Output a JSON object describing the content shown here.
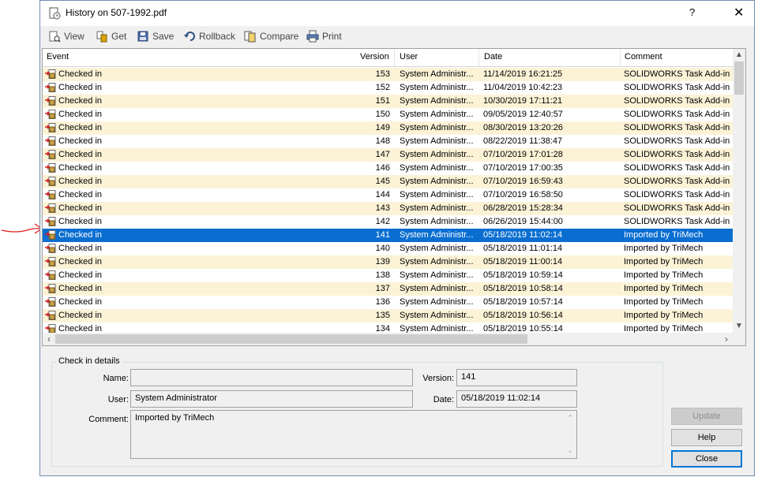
{
  "window": {
    "title": "History on 507-1992.pdf",
    "help_glyph": "?",
    "close_glyph": "✕"
  },
  "toolbar": {
    "view": "View",
    "get": "Get",
    "save": "Save",
    "rollback": "Rollback",
    "compare": "Compare",
    "print": "Print"
  },
  "columns": {
    "event": "Event",
    "version": "Version",
    "user": "User",
    "date": "Date",
    "comment": "Comment"
  },
  "rows": [
    {
      "event": "Checked in",
      "version": "153",
      "user": "System Administr...",
      "date": "11/14/2019 16:21:25",
      "comment": "SOLIDWORKS Task Add-in"
    },
    {
      "event": "Checked in",
      "version": "152",
      "user": "System Administr...",
      "date": "11/04/2019 10:42:23",
      "comment": "SOLIDWORKS Task Add-in"
    },
    {
      "event": "Checked in",
      "version": "151",
      "user": "System Administr...",
      "date": "10/30/2019 17:11:21",
      "comment": "SOLIDWORKS Task Add-in"
    },
    {
      "event": "Checked in",
      "version": "150",
      "user": "System Administr...",
      "date": "09/05/2019 12:40:57",
      "comment": "SOLIDWORKS Task Add-in"
    },
    {
      "event": "Checked in",
      "version": "149",
      "user": "System Administr...",
      "date": "08/30/2019 13:20:26",
      "comment": "SOLIDWORKS Task Add-in"
    },
    {
      "event": "Checked in",
      "version": "148",
      "user": "System Administr...",
      "date": "08/22/2019 11:38:47",
      "comment": "SOLIDWORKS Task Add-in"
    },
    {
      "event": "Checked in",
      "version": "147",
      "user": "System Administr...",
      "date": "07/10/2019 17:01:28",
      "comment": "SOLIDWORKS Task Add-in"
    },
    {
      "event": "Checked in",
      "version": "146",
      "user": "System Administr...",
      "date": "07/10/2019 17:00:35",
      "comment": "SOLIDWORKS Task Add-in"
    },
    {
      "event": "Checked in",
      "version": "145",
      "user": "System Administr...",
      "date": "07/10/2019 16:59:43",
      "comment": "SOLIDWORKS Task Add-in"
    },
    {
      "event": "Checked in",
      "version": "144",
      "user": "System Administr...",
      "date": "07/10/2019 16:58:50",
      "comment": "SOLIDWORKS Task Add-in"
    },
    {
      "event": "Checked in",
      "version": "143",
      "user": "System Administr...",
      "date": "06/28/2019 15:28:34",
      "comment": "SOLIDWORKS Task Add-in"
    },
    {
      "event": "Checked in",
      "version": "142",
      "user": "System Administr...",
      "date": "06/26/2019 15:44:00",
      "comment": "SOLIDWORKS Task Add-in"
    },
    {
      "event": "Checked in",
      "version": "141",
      "user": "System Administr...",
      "date": "05/18/2019 11:02:14",
      "comment": "Imported by TriMech"
    },
    {
      "event": "Checked in",
      "version": "140",
      "user": "System Administr...",
      "date": "05/18/2019 11:01:14",
      "comment": "Imported by TriMech"
    },
    {
      "event": "Checked in",
      "version": "139",
      "user": "System Administr...",
      "date": "05/18/2019 11:00:14",
      "comment": "Imported by TriMech"
    },
    {
      "event": "Checked in",
      "version": "138",
      "user": "System Administr...",
      "date": "05/18/2019 10:59:14",
      "comment": "Imported by TriMech"
    },
    {
      "event": "Checked in",
      "version": "137",
      "user": "System Administr...",
      "date": "05/18/2019 10:58:14",
      "comment": "Imported by TriMech"
    },
    {
      "event": "Checked in",
      "version": "136",
      "user": "System Administr...",
      "date": "05/18/2019 10:57:14",
      "comment": "Imported by TriMech"
    },
    {
      "event": "Checked in",
      "version": "135",
      "user": "System Administr...",
      "date": "05/18/2019 10:56:14",
      "comment": "Imported by TriMech"
    },
    {
      "event": "Checked in",
      "version": "134",
      "user": "System Administr...",
      "date": "05/18/2019 10:55:14",
      "comment": "Imported by TriMech"
    }
  ],
  "selected_version": "141",
  "details": {
    "group_title": "Check in details",
    "name_label": "Name:",
    "name_value": "",
    "version_label": "Version:",
    "version_value": "141",
    "user_label": "User:",
    "user_value": "System Administrator",
    "date_label": "Date:",
    "date_value": "05/18/2019 11:02:14",
    "comment_label": "Comment:",
    "comment_value": "Imported by TriMech"
  },
  "buttons": {
    "update": "Update",
    "help": "Help",
    "close": "Close"
  },
  "colors": {
    "selection": "#0a6ed1",
    "alt_row": "#fcf3d7",
    "annotation_arrow": "#e21b1b"
  }
}
